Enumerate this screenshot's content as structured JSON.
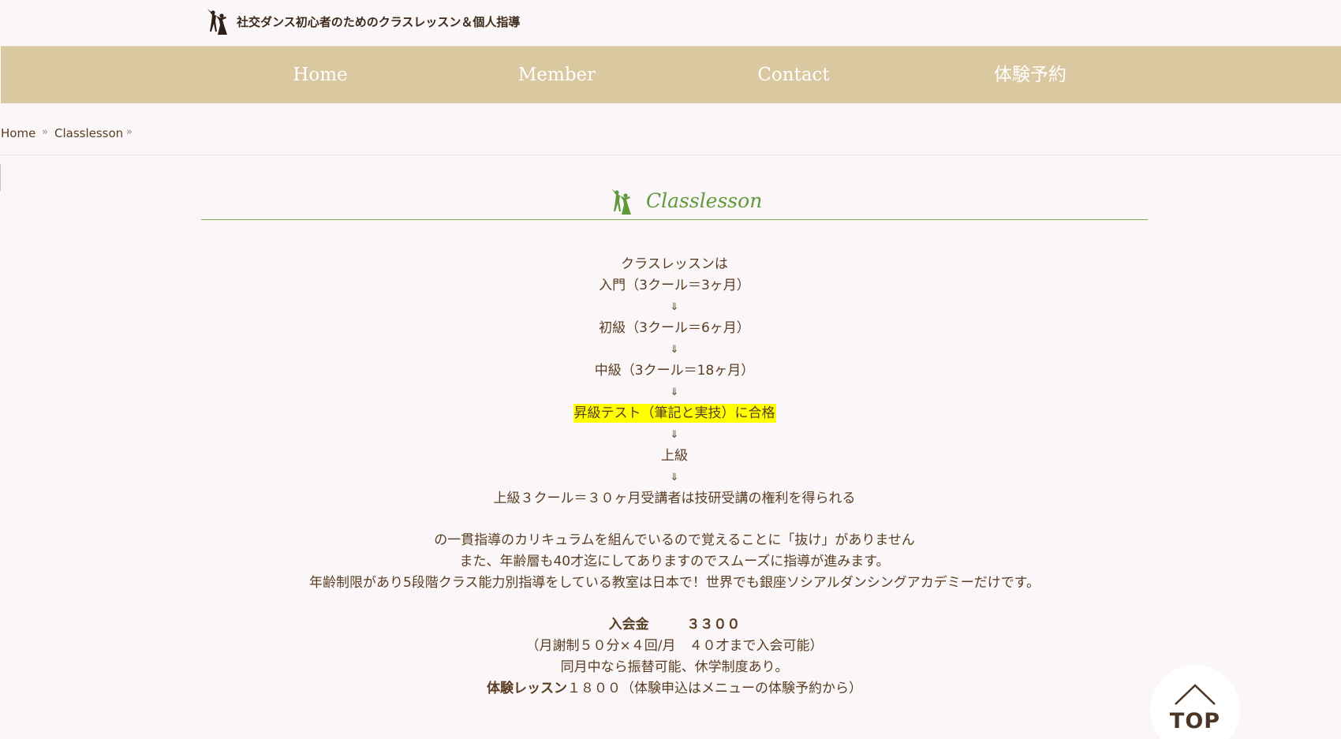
{
  "header": {
    "tagline": "社交ダンス初心者のためのクラスレッスン＆個人指導",
    "logo_icon": "dancing-couple-icon"
  },
  "nav": {
    "items": [
      {
        "label": "Home"
      },
      {
        "label": "Member"
      },
      {
        "label": "Contact"
      },
      {
        "label": "体験予約"
      }
    ]
  },
  "breadcrumb": {
    "items": [
      {
        "label": "Home"
      },
      {
        "label": "Classlesson"
      }
    ],
    "separator": "»"
  },
  "section": {
    "title": "Classlesson"
  },
  "curriculum": {
    "intro": "クラスレッスンは",
    "step1": "入門（3クール＝3ヶ月）",
    "step2": "初級（3クール＝6ヶ月）",
    "step3": "中級（3クール＝18ヶ月）",
    "test": "昇級テスト（筆記と実技）に合格",
    "step4": "上級",
    "step5": "上級３クール＝３０ヶ月受講者は技研受講の権利を得られる",
    "arrow": "⇓"
  },
  "description": {
    "line1": "の一貫指導のカリキュラムを組んでいるので覚えることに「抜け」がありません",
    "line2": "また、年齢層も40才迄にしてありますのでスムーズに指導が進みます。",
    "line3": "年齢制限があり5段階クラス能力別指導をしている教室は日本で！世界でも銀座ソシアルダンシングアカデミーだけです。"
  },
  "pricing": {
    "fee_label": "入会金",
    "fee_value": "３３００",
    "monthly": "（月謝制５０分×４回/月　４０才まで入会可能）",
    "transfer": "同月中なら振替可能、休学制度あり。",
    "trial_label": "体験レッスン",
    "trial_value": "１８００（体験申込はメニューの体験予約から）"
  },
  "back_to_top": {
    "label": "TOP"
  },
  "colors": {
    "nav_bg": "#d9c8a0",
    "accent_green": "#5f9a3a",
    "highlight": "#ffff00",
    "text": "#5a3d22"
  }
}
